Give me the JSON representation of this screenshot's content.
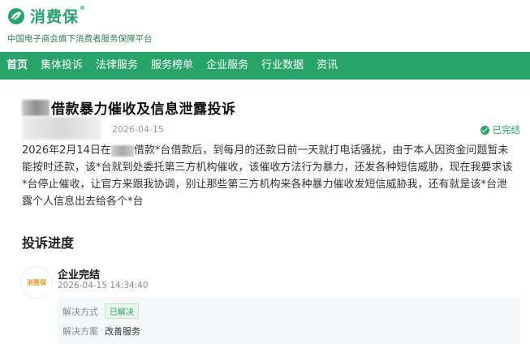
{
  "brand": {
    "name": "消费保",
    "reg": "®",
    "tagline": "中国电子商会旗下消费者服务保障平台",
    "color": "#28a369"
  },
  "nav": {
    "items": [
      "首页",
      "集体投诉",
      "法律服务",
      "服务榜单",
      "企业服务",
      "行业数据",
      "资讯"
    ],
    "active_index": 0
  },
  "complaint": {
    "title": "借款暴力催收及信息泄露投诉",
    "date": "2026-04-15",
    "status": "已完结",
    "status_icon": "check-circle-icon",
    "description_part1": "2026年2月14日在",
    "description_part2": "借款*台借款后，到每月的还款日前一天就打电话骚扰，由于本人因资金问题暂未能按时还款，该*台就到处委托第三方机构催收，该催收方法行为暴力，还发各种短信威胁，现在我要求该*台停止催收，让官方来跟我协调，别让那些第三方机构来各种暴力催收发短信威胁我，还有就是该*台泄露个人信息出去给各个*台"
  },
  "progress": {
    "title": "投诉进度",
    "entries": [
      {
        "avatar_text": "消费保",
        "actor": "企业完结",
        "time": "2026-04-15 14:34:40",
        "method_label": "解决方式",
        "method_value": "已解决",
        "plan_label": "解决方案",
        "plan_value": "改善服务"
      }
    ]
  }
}
